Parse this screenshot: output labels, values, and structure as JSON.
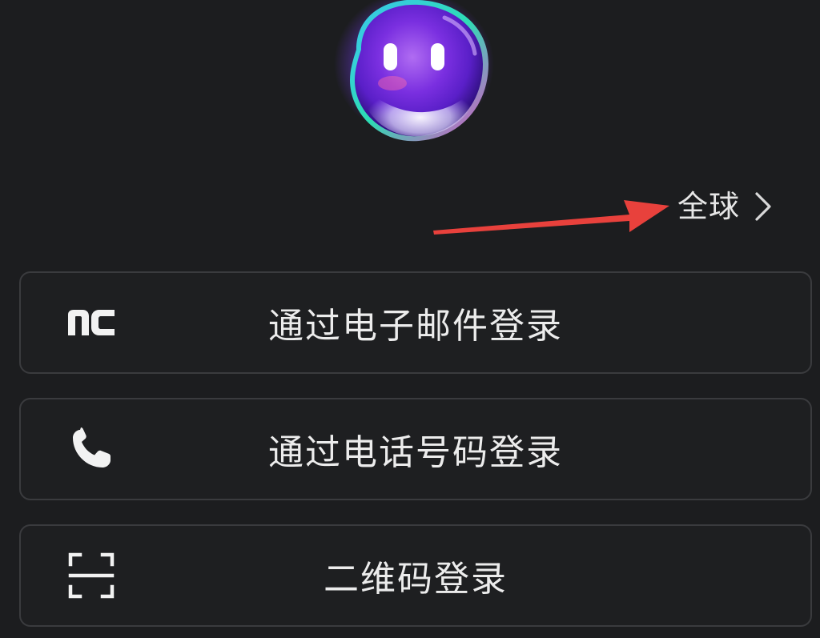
{
  "region": {
    "label": "全球",
    "icon": "chevron-right-icon"
  },
  "login_options": [
    {
      "icon": "nc-logo-icon",
      "label": "通过电子邮件登录"
    },
    {
      "icon": "phone-icon",
      "label": "通过电话号码登录"
    },
    {
      "icon": "qr-scan-icon",
      "label": "二维码登录"
    }
  ],
  "colors": {
    "background": "#1c1d1f",
    "button_border": "#3a3b3e",
    "text": "#ececec",
    "annotation_arrow": "#e8413c"
  }
}
